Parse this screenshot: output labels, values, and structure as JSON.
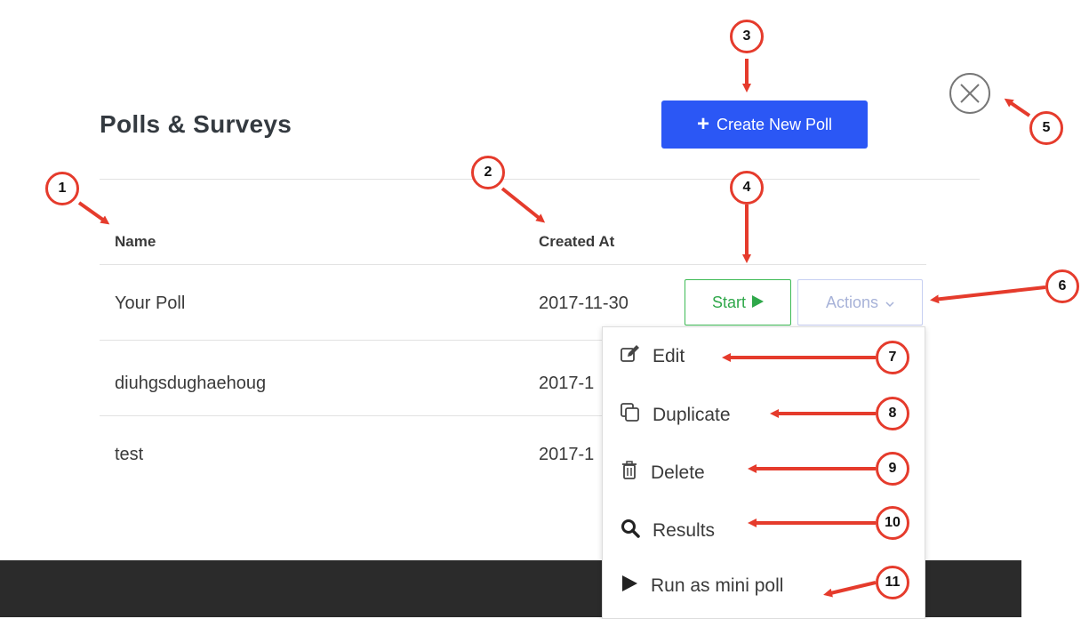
{
  "header": {
    "title": "Polls & Surveys",
    "create_label": "Create New Poll"
  },
  "table": {
    "columns": [
      "Name",
      "Created At"
    ],
    "rows": [
      {
        "name": "Your Poll",
        "created": "2017-11-30"
      },
      {
        "name": "diuhgsdughaehoug",
        "created": "2017-1"
      },
      {
        "name": "test",
        "created": "2017-1"
      }
    ]
  },
  "row_actions": {
    "start_label": "Start",
    "actions_label": "Actions"
  },
  "dropdown": {
    "items": [
      {
        "label": "Edit",
        "icon": "edit-icon"
      },
      {
        "label": "Duplicate",
        "icon": "duplicate-icon"
      },
      {
        "label": "Delete",
        "icon": "trash-icon"
      },
      {
        "label": "Results",
        "icon": "search-icon"
      },
      {
        "label": "Run as mini poll",
        "icon": "play-icon"
      }
    ]
  },
  "callouts": [
    "1",
    "2",
    "3",
    "4",
    "5",
    "6",
    "7",
    "8",
    "9",
    "10",
    "11"
  ],
  "colors": {
    "primary": "#2b57f5",
    "success": "#3cba54",
    "annotation": "#e53b2c",
    "footer": "#2b2b2b"
  }
}
